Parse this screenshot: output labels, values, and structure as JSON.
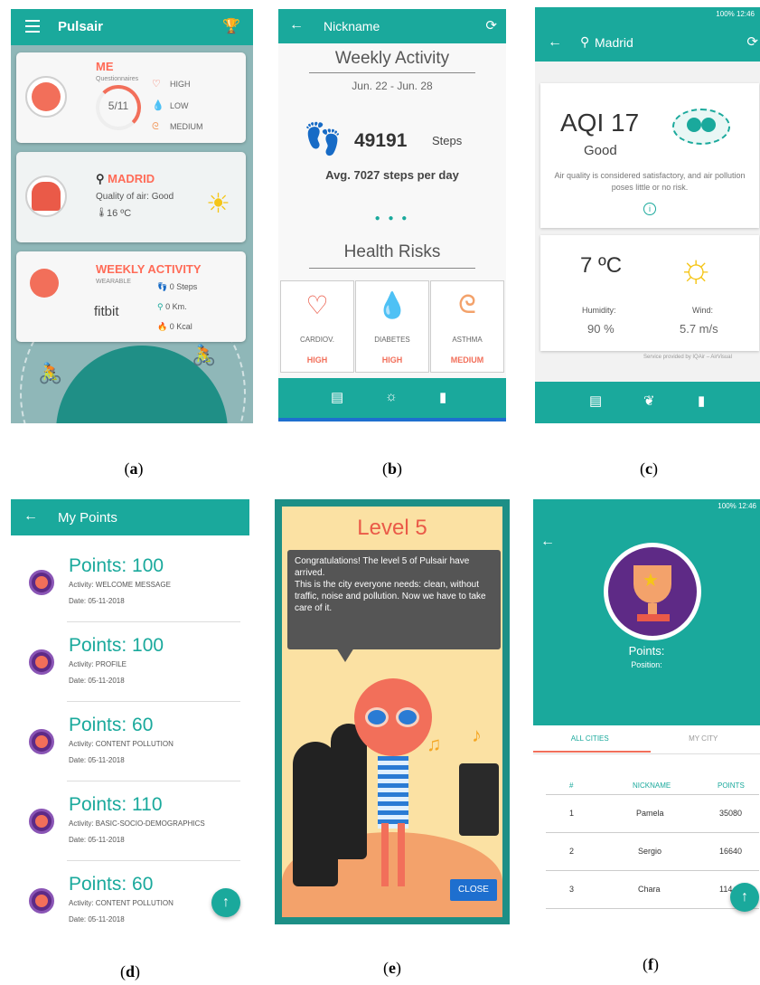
{
  "panel_a": {
    "title": "Pulsair",
    "me_card": {
      "title": "ME",
      "sub": "Questionnaires",
      "progress": "5/11",
      "progress_fraction": 0.45,
      "risks": [
        "HIGH",
        "LOW",
        "MEDIUM"
      ]
    },
    "city_card": {
      "city": "MADRID",
      "quality": "Quality of air: Good",
      "temp": "16 ºC"
    },
    "activity_card": {
      "title": "WEEKLY ACTIVITY",
      "sub": "WEARABLE",
      "brand": "fitbit",
      "steps": "0 Steps",
      "km": "0 Km.",
      "kcal": "0 Kcal"
    }
  },
  "panel_b": {
    "title": "Nickname",
    "section1": "Weekly Activity",
    "dates": "Jun. 22 - Jun. 28",
    "steps_value": "49191",
    "steps_unit": "Steps",
    "avg": "Avg. 7027 steps per day",
    "section2": "Health Risks",
    "risks": [
      {
        "label": "CARDIOV.",
        "value": "HIGH"
      },
      {
        "label": "DIABETES",
        "value": "HIGH"
      },
      {
        "label": "ASTHMA",
        "value": "MEDIUM"
      }
    ]
  },
  "panel_c": {
    "status": "100% 12:46",
    "title": "Madrid",
    "aqi": "AQI 17",
    "aqi_label": "Good",
    "aqi_desc": "Air quality is considered satisfactory, and air pollution poses little or no risk.",
    "temp": "7 ºC",
    "humidity_label": "Humidity:",
    "humidity_value": "90 %",
    "wind_label": "Wind:",
    "wind_value": "5.7 m/s",
    "credit": "Service provided by IQAir – AirVisual"
  },
  "panel_d": {
    "title": "My Points",
    "items": [
      {
        "points": "Points: 100",
        "activity": "Activity: WELCOME MESSAGE",
        "date": "Date: 05-11-2018"
      },
      {
        "points": "Points: 100",
        "activity": "Activity: PROFILE",
        "date": "Date: 05-11-2018"
      },
      {
        "points": "Points: 60",
        "activity": "Activity: CONTENT POLLUTION",
        "date": "Date: 05-11-2018"
      },
      {
        "points": "Points: 110",
        "activity": "Activity: BASIC-SOCIO-DEMOGRAPHICS",
        "date": "Date: 05-11-2018"
      },
      {
        "points": "Points: 60",
        "activity": "Activity: CONTENT POLLUTION",
        "date": "Date: 05-11-2018"
      }
    ]
  },
  "panel_e": {
    "level": "Level 5",
    "message_1": "Congratulations! The level 5 of Pulsair have arrived.",
    "message_2": "This is the city everyone needs: clean, without traffic, noise and pollution. Now we have to take care of it.",
    "close": "CLOSE"
  },
  "panel_f": {
    "status": "100% 12:46",
    "points_label": "Points:",
    "position_label": "Position:",
    "tab_all": "ALL CITIES",
    "tab_my": "MY CITY",
    "headers": [
      "#",
      "NICKNAME",
      "POINTS"
    ],
    "rows": [
      {
        "rank": "1",
        "name": "Pamela",
        "points": "35080"
      },
      {
        "rank": "2",
        "name": "Sergio",
        "points": "16640"
      },
      {
        "rank": "3",
        "name": "Chara",
        "points": "114"
      }
    ]
  },
  "captions": [
    "a",
    "b",
    "c",
    "d",
    "e",
    "f"
  ],
  "colors": {
    "teal": "#1aa99c",
    "coral": "#f26f5a",
    "purple": "#5e2a86",
    "sun": "#f5c518"
  }
}
